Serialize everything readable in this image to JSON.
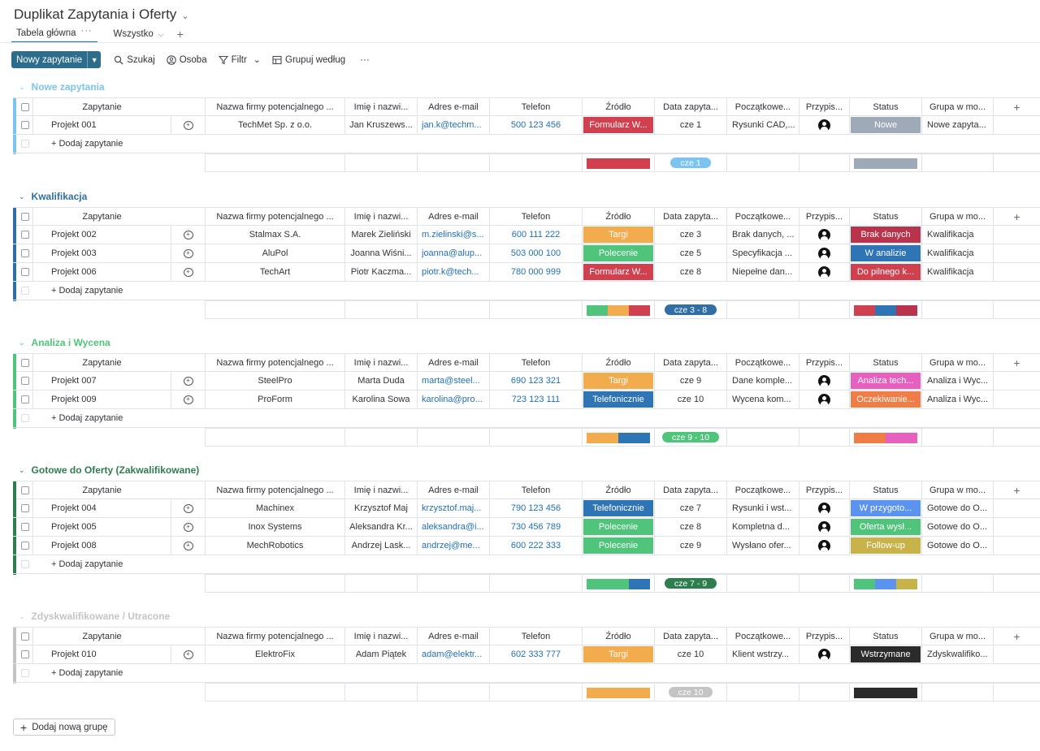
{
  "board": {
    "title": "Duplikat Zapytania i Oferty",
    "views": [
      {
        "label": "Tabela główna",
        "dots": "···"
      },
      {
        "label": "Wszystko"
      }
    ],
    "add_view": "+"
  },
  "toolbar": {
    "new_label": "Nowy zapytanie",
    "search_label": "Szukaj",
    "person_label": "Osoba",
    "filter_label": "Filtr",
    "group_by_label": "Grupuj według",
    "more": "···"
  },
  "columns": {
    "item": "Zapytanie",
    "company": "Nazwa firmy potencjalnego ...",
    "name": "Imię i nazwi...",
    "email": "Adres e-mail",
    "phone": "Telefon",
    "source": "Źródło",
    "date": "Data zapyta...",
    "initial": "Początkowe...",
    "assigned": "Przypis...",
    "status": "Status",
    "group": "Grupa w mo...",
    "add": "+"
  },
  "add_item_label": "+ Dodaj zapytanie",
  "add_group_label": "Dodaj nową grupę",
  "colors": {
    "form": "#d0404f",
    "fair": "#f2ac4d",
    "referral": "#4fc47a",
    "phone": "#2f74b5",
    "status_new": "#9eaab8",
    "status_no_data": "#b8334b",
    "status_analysis": "#2f74b5",
    "status_followup": "#c8b24a",
    "status_tech": "#e75fbf",
    "status_waiting": "#f07d45",
    "status_preparing": "#5b93f0",
    "status_offer_sent": "#4fc47a",
    "status_suspended": "#2b2b2b"
  },
  "groups": [
    {
      "title": "Nowe zapytania",
      "color": "#7cc4f0",
      "rows": [
        {
          "item": "Projekt 001",
          "company": "TechMet Sp. z o.o.",
          "name": "Jan Kruszews...",
          "email": "jan.k@techm...",
          "phone": "500 123 456",
          "source": "Formularz W...",
          "source_color": "#d0404f",
          "date": "cze 1",
          "initial": "Rysunki CAD,...",
          "status": "Nowe",
          "status_color": "#9eaab8",
          "group": "Nowe zapyta..."
        }
      ],
      "summary": {
        "source_bar": [
          {
            "c": "#d0404f",
            "w": 1
          }
        ],
        "date_range": "cze 1",
        "date_color": "#7cc4f0",
        "status_bar": [
          {
            "c": "#9eaab8",
            "w": 1
          }
        ]
      }
    },
    {
      "title": "Kwalifikacja",
      "color": "#2f6fa5",
      "rows": [
        {
          "item": "Projekt 002",
          "company": "Stalmax S.A.",
          "name": "Marek Zieliński",
          "email": "m.zielinski@s...",
          "phone": "600 111 222",
          "source": "Targi",
          "source_color": "#f2ac4d",
          "date": "cze 3",
          "initial": "Brak danych, ...",
          "status": "Brak danych",
          "status_color": "#b8334b",
          "group": "Kwalifikacja"
        },
        {
          "item": "Projekt 003",
          "company": "AluPol",
          "name": "Joanna Wiśni...",
          "email": "joanna@alup...",
          "phone": "503 000 100",
          "source": "Polecenie",
          "source_color": "#4fc47a",
          "date": "cze 5",
          "initial": "Specyfikacja ...",
          "status": "W analizie",
          "status_color": "#2f74b5",
          "group": "Kwalifikacja"
        },
        {
          "item": "Projekt 006",
          "company": "TechArt",
          "name": "Piotr Kaczma...",
          "email": "piotr.k@tech...",
          "phone": "780 000 999",
          "source": "Formularz W...",
          "source_color": "#d0404f",
          "date": "cze 8",
          "initial": "Niepełne dan...",
          "status": "Do pilnego k...",
          "status_color": "#d0404f",
          "group": "Kwalifikacja"
        }
      ],
      "summary": {
        "source_bar": [
          {
            "c": "#4fc47a",
            "w": 1
          },
          {
            "c": "#f2ac4d",
            "w": 1
          },
          {
            "c": "#d0404f",
            "w": 1
          }
        ],
        "date_range": "cze 3 - 8",
        "date_color": "#2f6fa5",
        "status_bar": [
          {
            "c": "#d0404f",
            "w": 1
          },
          {
            "c": "#2f74b5",
            "w": 1
          },
          {
            "c": "#b8334b",
            "w": 1
          }
        ]
      }
    },
    {
      "title": "Analiza i Wycena",
      "color": "#4fc47a",
      "rows": [
        {
          "item": "Projekt 007",
          "company": "SteelPro",
          "name": "Marta Duda",
          "email": "marta@steel...",
          "phone": "690 123 321",
          "source": "Targi",
          "source_color": "#f2ac4d",
          "date": "cze 9",
          "initial": "Dane komple...",
          "status": "Analiza tech...",
          "status_color": "#e75fbf",
          "group": "Analiza i Wyc..."
        },
        {
          "item": "Projekt 009",
          "company": "ProForm",
          "name": "Karolina Sowa",
          "email": "karolina@pro...",
          "phone": "723 123 111",
          "source": "Telefonicznie",
          "source_color": "#2f74b5",
          "date": "cze 10",
          "initial": "Wycena kom...",
          "status": "Oczekiwanie...",
          "status_color": "#f07d45",
          "group": "Analiza i Wyc..."
        }
      ],
      "summary": {
        "source_bar": [
          {
            "c": "#f2ac4d",
            "w": 1
          },
          {
            "c": "#2f74b5",
            "w": 1
          }
        ],
        "date_range": "cze 9 - 10",
        "date_color": "#4fc47a",
        "status_bar": [
          {
            "c": "#f07d45",
            "w": 1
          },
          {
            "c": "#e75fbf",
            "w": 1
          }
        ]
      }
    },
    {
      "title": "Gotowe do Oferty (Zakwalifikowane)",
      "color": "#2e7d4f",
      "rows": [
        {
          "item": "Projekt 004",
          "company": "Machinex",
          "name": "Krzysztof Maj",
          "email": "krzysztof.maj...",
          "phone": "790 123 456",
          "source": "Telefonicznie",
          "source_color": "#2f74b5",
          "date": "cze 7",
          "initial": "Rysunki i wst...",
          "status": "W przygoto...",
          "status_color": "#5b93f0",
          "group": "Gotowe do O..."
        },
        {
          "item": "Projekt 005",
          "company": "Inox Systems",
          "name": "Aleksandra Kr...",
          "email": "aleksandra@i...",
          "phone": "730 456 789",
          "source": "Polecenie",
          "source_color": "#4fc47a",
          "date": "cze 8",
          "initial": "Kompletna d...",
          "status": "Oferta wysł...",
          "status_color": "#4fc47a",
          "group": "Gotowe do O..."
        },
        {
          "item": "Projekt 008",
          "company": "MechRobotics",
          "name": "Andrzej Lask...",
          "email": "andrzej@me...",
          "phone": "600 222 333",
          "source": "Polecenie",
          "source_color": "#4fc47a",
          "date": "cze 9",
          "initial": "Wysłano ofer...",
          "status": "Follow-up",
          "status_color": "#c8b24a",
          "group": "Gotowe do O..."
        }
      ],
      "summary": {
        "source_bar": [
          {
            "c": "#4fc47a",
            "w": 2
          },
          {
            "c": "#2f74b5",
            "w": 1
          }
        ],
        "date_range": "cze 7 - 9",
        "date_color": "#2e7d4f",
        "status_bar": [
          {
            "c": "#4fc47a",
            "w": 1
          },
          {
            "c": "#5b93f0",
            "w": 1
          },
          {
            "c": "#c8b24a",
            "w": 1
          }
        ]
      }
    },
    {
      "title": "Zdyskwalifikowane / Utracone",
      "color": "#c4c4c4",
      "rows": [
        {
          "item": "Projekt 010",
          "company": "ElektroFix",
          "name": "Adam Piątek",
          "email": "adam@elektr...",
          "phone": "602 333 777",
          "source": "Targi",
          "source_color": "#f2ac4d",
          "date": "cze 10",
          "initial": "Klient wstrzy...",
          "status": "Wstrzymane",
          "status_color": "#2b2b2b",
          "group": "Zdyskwalifiko..."
        }
      ],
      "summary": {
        "source_bar": [
          {
            "c": "#f2ac4d",
            "w": 1
          }
        ],
        "date_range": "cze 10",
        "date_color": "#c4c4c4",
        "status_bar": [
          {
            "c": "#2b2b2b",
            "w": 1
          }
        ]
      }
    }
  ]
}
